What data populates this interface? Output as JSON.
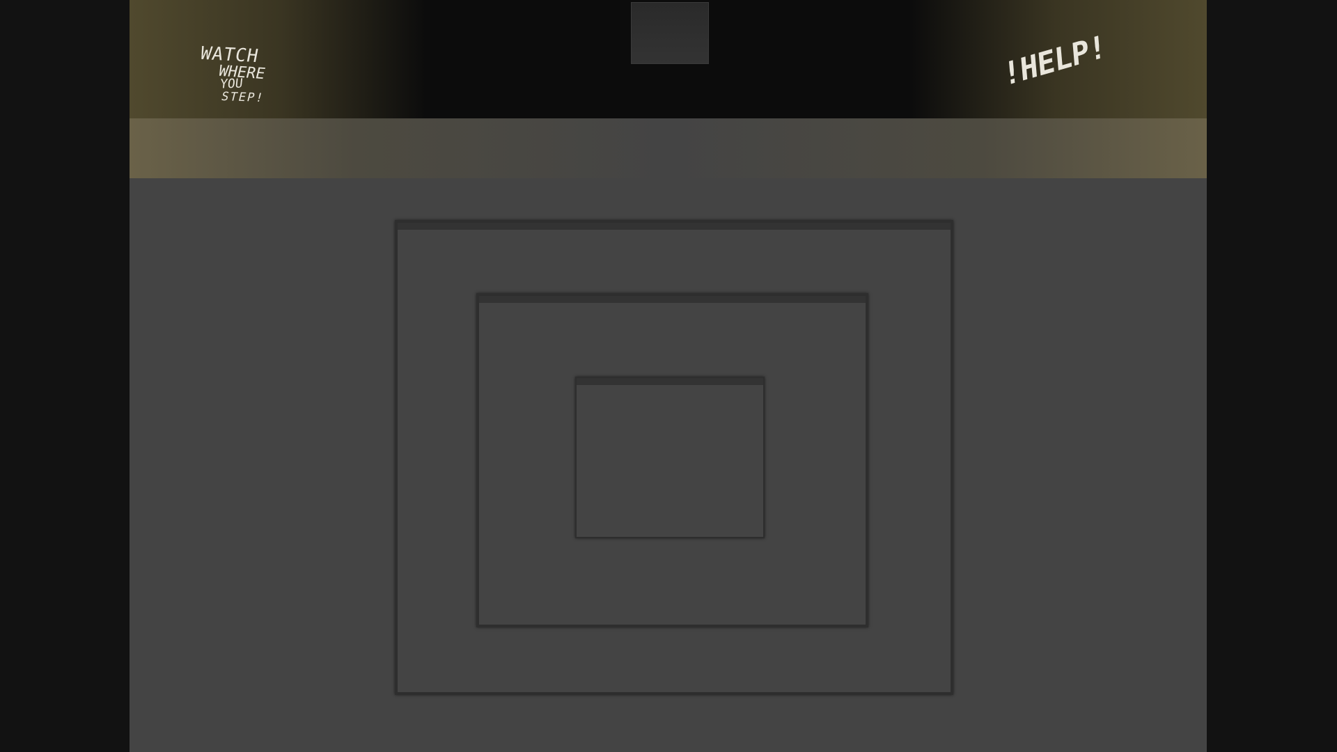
{
  "scene": {
    "type": "first-person corridor view",
    "colors": {
      "wall": "#121212",
      "floor": "#444444",
      "ceiling_light": "#5a5233",
      "graffiti": "#e9e6dc"
    }
  },
  "graffiti": {
    "left_lines": [
      "WATCH",
      "WHERE",
      "YOU",
      "STEP!"
    ],
    "right_text": "!HELP!"
  }
}
